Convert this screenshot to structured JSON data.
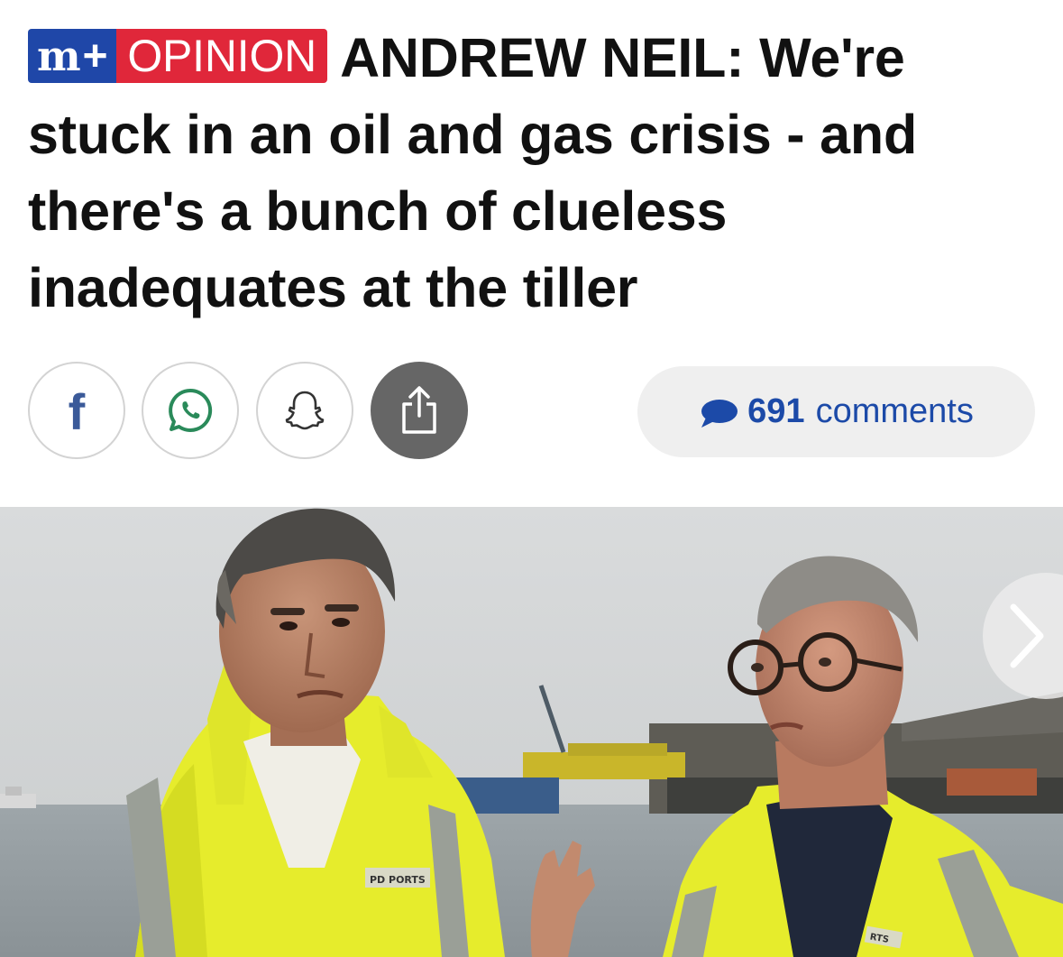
{
  "badge": {
    "brand_mark": "m",
    "brand_plus": "+",
    "section_label": "OPINION"
  },
  "headline": {
    "author": "ANDREW NEIL:",
    "text": "We're stuck in an oil and gas crisis - and there's a bunch of clueless inadequates at the tiller"
  },
  "share": {
    "facebook_label": "f",
    "buttons": [
      "facebook-icon",
      "whatsapp-icon",
      "snapchat-icon",
      "share-icon"
    ]
  },
  "comments": {
    "count": "691",
    "label": "comments"
  },
  "photo": {
    "jacket_label_left": "PD PORTS",
    "jacket_label_right": "RTS"
  },
  "colors": {
    "brand_blue": "#1f47a8",
    "opinion_red": "#e0273a",
    "comments_blue": "#1c4aa8",
    "hi_vis_yellow": "#e8ee2a"
  }
}
